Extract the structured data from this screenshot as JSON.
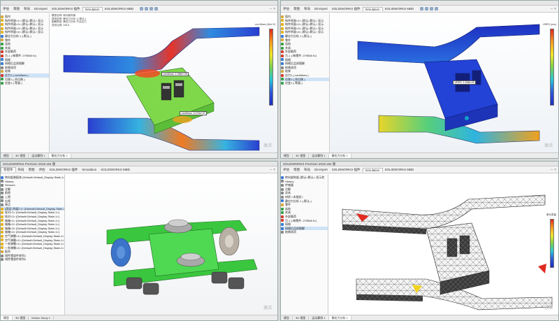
{
  "panel1": {
    "title": "",
    "tabs": [
      "评估",
      "草图",
      "布局",
      "DimXpert",
      "SOLIDWORKS 插件",
      "Simulation",
      "SOLIDWORKS MBD"
    ],
    "info": [
      "模型名称: 转向架构架",
      "算例名称: 静应力分析 1(-默认-)",
      "图解类型: 静应力分析 节点应力",
      "变形比例: 206.6"
    ],
    "tree": [
      {
        "label": "面内",
        "icon": "folder"
      },
      {
        "label": "构件杯副<1> (默认<默认> 显示",
        "icon": "yellow"
      },
      {
        "label": "构件杯副<2> (默认<默认> 显示",
        "icon": "yellow"
      },
      {
        "label": "构件杯副<3> (默认<默认> 显示",
        "icon": "yellow"
      },
      {
        "label": "构件杯副<4> (默认<默认> 显示",
        "icon": "yellow"
      },
      {
        "label": "静应力分析 1 (-默认-)",
        "icon": "blue"
      },
      {
        "label": "零件",
        "icon": "folder"
      },
      {
        "label": "连结",
        "icon": "green"
      },
      {
        "label": "夹具",
        "icon": "green"
      },
      {
        "label": "外部载荷",
        "icon": "red"
      },
      {
        "label": "力-1 (:每零件: 279558 N:)",
        "icon": "red"
      },
      {
        "label": "网格",
        "icon": "blue"
      },
      {
        "label": "网格后品质图解",
        "icon": "blue"
      },
      {
        "label": "结果选项",
        "icon": "gray"
      },
      {
        "label": "结果",
        "icon": "folder"
      },
      {
        "label": "应力1 (-vonMises-)",
        "icon": "red",
        "selected": true
      },
      {
        "label": "位移1 (-合位移-)",
        "icon": "green"
      },
      {
        "label": "应变1 (-等量-)",
        "icon": "green"
      }
    ],
    "callouts": [
      "vonMises: 1.086e+08",
      "vonMises: 9.476e+07"
    ],
    "legend_label": "von Mises (N/m^2)",
    "status": [
      "模型",
      "3D 视图",
      "运动算例 1",
      "静应力分析 1"
    ],
    "watermark": "激活"
  },
  "panel2": {
    "title": "",
    "tabs": [
      "评估",
      "草图",
      "布局",
      "DimXpert",
      "SOLIDWORKS 插件",
      "Simulation",
      "SOLIDWORKS MBD"
    ],
    "info": [
      "模型名称: 转向架构架",
      "算例名称: 静应力分析 1(-默认-)",
      "图解类型: 静应力分析 位移",
      "变形比例: 206.6"
    ],
    "tree": [
      {
        "label": "面内",
        "icon": "folder"
      },
      {
        "label": "构件杯副<1> (默认<默认> 显示",
        "icon": "yellow"
      },
      {
        "label": "构件杯副<2> (默认<默认> 显示",
        "icon": "yellow"
      },
      {
        "label": "构件杯副<3> (默认<默认> 显示",
        "icon": "yellow"
      },
      {
        "label": "构件杯副<4> (默认<默认> 显示",
        "icon": "yellow"
      },
      {
        "label": "静应力分析 1 (-默认-)",
        "icon": "blue"
      },
      {
        "label": "零件",
        "icon": "folder"
      },
      {
        "label": "连结",
        "icon": "green"
      },
      {
        "label": "夹具",
        "icon": "green"
      },
      {
        "label": "外部载荷",
        "icon": "red"
      },
      {
        "label": "力-1 (:每零件: 279558 N:)",
        "icon": "red"
      },
      {
        "label": "网格",
        "icon": "blue"
      },
      {
        "label": "网格后品质图解",
        "icon": "blue"
      },
      {
        "label": "结果选项",
        "icon": "gray"
      },
      {
        "label": "结果",
        "icon": "folder"
      },
      {
        "label": "应力1 (-vonMises-)",
        "icon": "red"
      },
      {
        "label": "位移1 (-合位移-)",
        "icon": "green",
        "selected": true
      },
      {
        "label": "应变1 (-等量-)",
        "icon": "green"
      }
    ],
    "callouts": [
      "URES: 1.496e-03"
    ],
    "legend_label": "URES (mm)",
    "status": [
      "模型",
      "3D 视图",
      "运动算例 1",
      "静应力分析 1"
    ],
    "watermark": "激活"
  },
  "panel3": {
    "title": "SOLIDWORKS Premium 2018 x64 版",
    "tabs": [
      "装配体",
      "布局",
      "草图",
      "评估",
      "SOLIDWORKS 插件",
      "Simulation",
      "SOLIDWORKS MBD"
    ],
    "tree": [
      {
        "label": "转向架装配体 (Default<Default_Display State-1>)",
        "icon": "blue"
      },
      {
        "label": "History",
        "icon": "gray"
      },
      {
        "label": "Sensors",
        "icon": "gray"
      },
      {
        "label": "注解",
        "icon": "gray"
      },
      {
        "label": "前视",
        "icon": "gray"
      },
      {
        "label": "上视",
        "icon": "gray"
      },
      {
        "label": "右视",
        "icon": "gray"
      },
      {
        "label": "原点",
        "icon": "gray"
      },
      {
        "label": "(固定) 构架<1> (Default<Default_Display State-1>)",
        "icon": "yellow",
        "selected": true
      },
      {
        "label": "轮对<1> (Default<Default_Display State-1>)",
        "icon": "yellow"
      },
      {
        "label": "轮对<2> (Default<Default_Display State-1>)",
        "icon": "yellow"
      },
      {
        "label": "轴箱<1> (Default<Default_Display State-1>)",
        "icon": "yellow"
      },
      {
        "label": "轴箱<2> (Default<Default_Display State-1>)",
        "icon": "yellow"
      },
      {
        "label": "轴箱<3> (Default<Default_Display State-1>)",
        "icon": "yellow"
      },
      {
        "label": "轴箱<4> (Default<Default_Display State-1>)",
        "icon": "yellow"
      },
      {
        "label": "空气弹簧<1> (Default<Default_Display State-1>)",
        "icon": "yellow"
      },
      {
        "label": "空气弹簧<2> (Default<Default_Display State-1>)",
        "icon": "yellow"
      },
      {
        "label": "一系弹簧<1> (Default<Default_Display State-1>)",
        "icon": "yellow"
      },
      {
        "label": "一系弹簧<2> (Default<Default_Display State-1>)",
        "icon": "yellow"
      },
      {
        "label": "配合",
        "icon": "folder"
      },
      {
        "label": "线性零部件阵列1",
        "icon": "gray"
      },
      {
        "label": "线性零部件阵列2",
        "icon": "gray"
      }
    ],
    "status": [
      "模型",
      "3D 视图",
      "Motion Study 1"
    ],
    "watermark": "激活"
  },
  "panel4": {
    "title": "SOLIDWORKS Premium 2018 x64 版",
    "tabs": [
      "评估",
      "草图",
      "布局",
      "DimXpert",
      "SOLIDWORKS 插件",
      "Simulation",
      "SOLIDWORKS MBD"
    ],
    "info": [
      "模型名称: 转向架构架",
      "算例名称: 静应力分析 1(-默认-)",
      "图解类型: 网格品质 网格品质1",
      "单元数: 28458"
    ],
    "tree": [
      {
        "label": "转向架构架 (默认<默认> 显示状",
        "icon": "blue"
      },
      {
        "label": "History",
        "icon": "gray"
      },
      {
        "label": "传感器",
        "icon": "gray"
      },
      {
        "label": "注解",
        "icon": "gray"
      },
      {
        "label": "实体",
        "icon": "gray"
      },
      {
        "label": "材质 <未指定>",
        "icon": "gray"
      },
      {
        "label": "静应力分析 1 (-默认-)",
        "icon": "blue"
      },
      {
        "label": "零件",
        "icon": "folder"
      },
      {
        "label": "连结",
        "icon": "green"
      },
      {
        "label": "夹具",
        "icon": "green"
      },
      {
        "label": "外部载荷",
        "icon": "red"
      },
      {
        "label": "力-1 (:每零件: 279558 N:)",
        "icon": "red"
      },
      {
        "label": "网格",
        "icon": "blue"
      },
      {
        "label": "网格后品质图解",
        "icon": "blue",
        "selected": true
      },
      {
        "label": "结果选项",
        "icon": "gray"
      }
    ],
    "legend_label": "单元质量",
    "status": [
      "模型",
      "3D 视图",
      "运动算例 1",
      "静应力分析 1"
    ],
    "watermark": "激活"
  },
  "colors": {
    "stress_high": "#e0241b",
    "stress_mid": "#7ad24b",
    "stress_low": "#1b2cc0",
    "assembly_green": "#3ac73f",
    "wheel_blue": "#3b74c8",
    "mesh_dark": "#3a3a3a"
  }
}
